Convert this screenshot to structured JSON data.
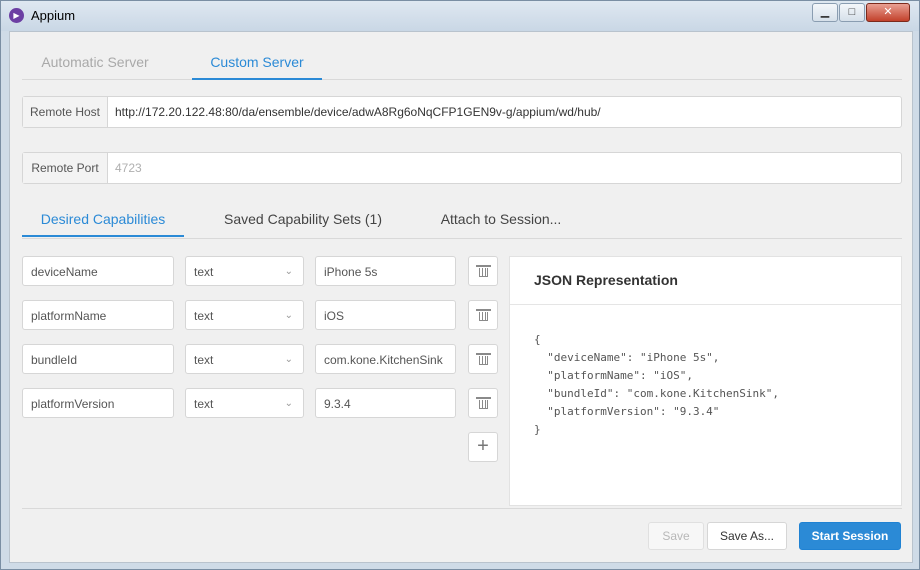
{
  "window": {
    "title": "Appium",
    "minimize": "▁",
    "maximize": "□",
    "close": "✕"
  },
  "server_tabs": [
    {
      "label": "Automatic Server",
      "active": false
    },
    {
      "label": "Custom Server",
      "active": true
    }
  ],
  "remote_host": {
    "label": "Remote Host",
    "value": "http://172.20.122.48:80/da/ensemble/device/adwA8Rg6oNqCFP1GEN9v-g/appium/wd/hub/"
  },
  "remote_port": {
    "label": "Remote Port",
    "placeholder": "4723"
  },
  "capability_tabs": [
    {
      "label": "Desired Capabilities",
      "active": true
    },
    {
      "label": "Saved Capability Sets (1)",
      "active": false
    },
    {
      "label": "Attach to Session...",
      "active": false
    }
  ],
  "capabilities": [
    {
      "name": "deviceName",
      "type": "text",
      "value": "iPhone 5s"
    },
    {
      "name": "platformName",
      "type": "text",
      "value": "iOS"
    },
    {
      "name": "bundleId",
      "type": "text",
      "value": "com.kone.KitchenSink"
    },
    {
      "name": "platformVersion",
      "type": "text",
      "value": "9.3.4"
    }
  ],
  "add_symbol": "+",
  "json_panel": {
    "title": "JSON Representation",
    "content": "{\n  \"deviceName\": \"iPhone 5s\",\n  \"platformName\": \"iOS\",\n  \"bundleId\": \"com.kone.KitchenSink\",\n  \"platformVersion\": \"9.3.4\"\n}"
  },
  "buttons": {
    "save": "Save",
    "save_as": "Save As...",
    "start": "Start Session"
  },
  "colors": {
    "accent": "#2b8ad6",
    "app_icon": "#6c3fa3"
  }
}
